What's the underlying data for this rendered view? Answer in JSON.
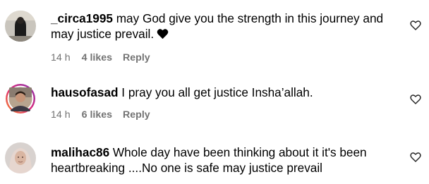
{
  "comments": [
    {
      "username": "_circa1995",
      "text_line1": "may God give you the strength in this journey and",
      "text_line2": "may justice prevail.",
      "emoji": "black-heart",
      "time": "14 h",
      "likes": "4 likes",
      "reply": "Reply"
    },
    {
      "username": "hausofasad",
      "text_line1": "I pray you all get justice Insha’allah.",
      "time": "14 h",
      "likes": "6 likes",
      "reply": "Reply"
    },
    {
      "username": "malihac86",
      "text_line1": "Whole day have been thinking about it it's been",
      "text_line2": "heartbreaking ....No one is safe may justice prevail"
    }
  ],
  "colors": {
    "meta": "#737373",
    "text": "#000000",
    "story_ring_start": "#f58529",
    "story_ring_end": "#8134af"
  },
  "icons": {
    "like": "heart-outline-icon"
  }
}
